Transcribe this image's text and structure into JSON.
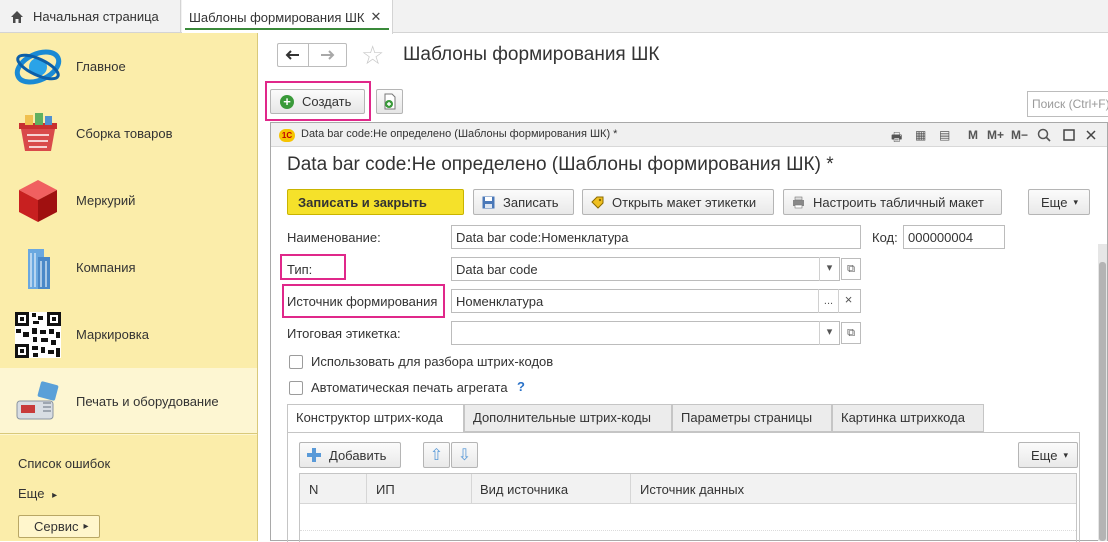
{
  "tabs": {
    "home_label": "Начальная страница",
    "current_label": "Шаблоны формирования ШК",
    "close_glyph": "✕"
  },
  "sidebar": {
    "items": [
      {
        "label": "Главное",
        "icon": "globe-icon"
      },
      {
        "label": "Сборка товаров",
        "icon": "basket-icon"
      },
      {
        "label": "Меркурий",
        "icon": "red-cube-icon"
      },
      {
        "label": "Компания",
        "icon": "building-icon"
      },
      {
        "label": "Маркировка",
        "icon": "qr-code-icon"
      },
      {
        "label": "Печать и оборудование",
        "icon": "cash-register-icon"
      }
    ],
    "errors_link": "Список ошибок",
    "more_link": "Еще",
    "service_button": "Сервис",
    "arrow": "▸"
  },
  "header": {
    "title": "Шаблоны формирования ШК",
    "back_glyph": "🡐",
    "forward_glyph": "→",
    "star_glyph": "☆"
  },
  "toolbar": {
    "create_label": "Создать",
    "search_placeholder": "Поиск (Ctrl+F)"
  },
  "window": {
    "title": "Data bar code:Не определено (Шаблоны формирования ШК) *",
    "logo": "1С",
    "tools": [
      "M",
      "M+",
      "M−"
    ],
    "form_title": "Data bar code:Не определено (Шаблоны формирования ШК) *"
  },
  "form": {
    "buttons": {
      "save_close": "Записать и закрыть",
      "save": "Записать",
      "open_template": "Открыть макет этикетки",
      "setup_table": "Настроить табличный макет",
      "more": "Еще"
    },
    "name_label": "Наименование:",
    "name_value": "Data bar code:Номенклатура",
    "code_label": "Код:",
    "code_value": "000000004",
    "type_label": "Тип:",
    "type_value": "Data bar code",
    "source_label": "Источник формирования",
    "source_value": "Номенклатура",
    "final_label_label": "Итоговая этикетка:",
    "final_label_value": "",
    "use_for_parsing": "Использовать для разбора штрих-кодов",
    "auto_print": "Автоматическая печать агрегата",
    "help_glyph": "?",
    "dropdown_glyph": "▾",
    "dots_glyph": "...",
    "clear_glyph": "×",
    "open_glyph": "⧉"
  },
  "inner_tabs": [
    "Конструктор штрих-кода",
    "Дополнительные штрих-коды",
    "Параметры страницы",
    "Картинка штрихкода"
  ],
  "table_toolbar": {
    "add_label": "Добавить",
    "more_label": "Еще",
    "up_glyph": "⇧",
    "down_glyph": "⇩"
  },
  "grid": {
    "columns": [
      "N",
      "ИП",
      "Вид источника",
      "Источник данных"
    ]
  },
  "colors": {
    "sidebar_bg": "#fbedaa",
    "primary_button": "#f5e12a",
    "highlight": "#e0288a",
    "accent_green": "#3a8a3a"
  }
}
